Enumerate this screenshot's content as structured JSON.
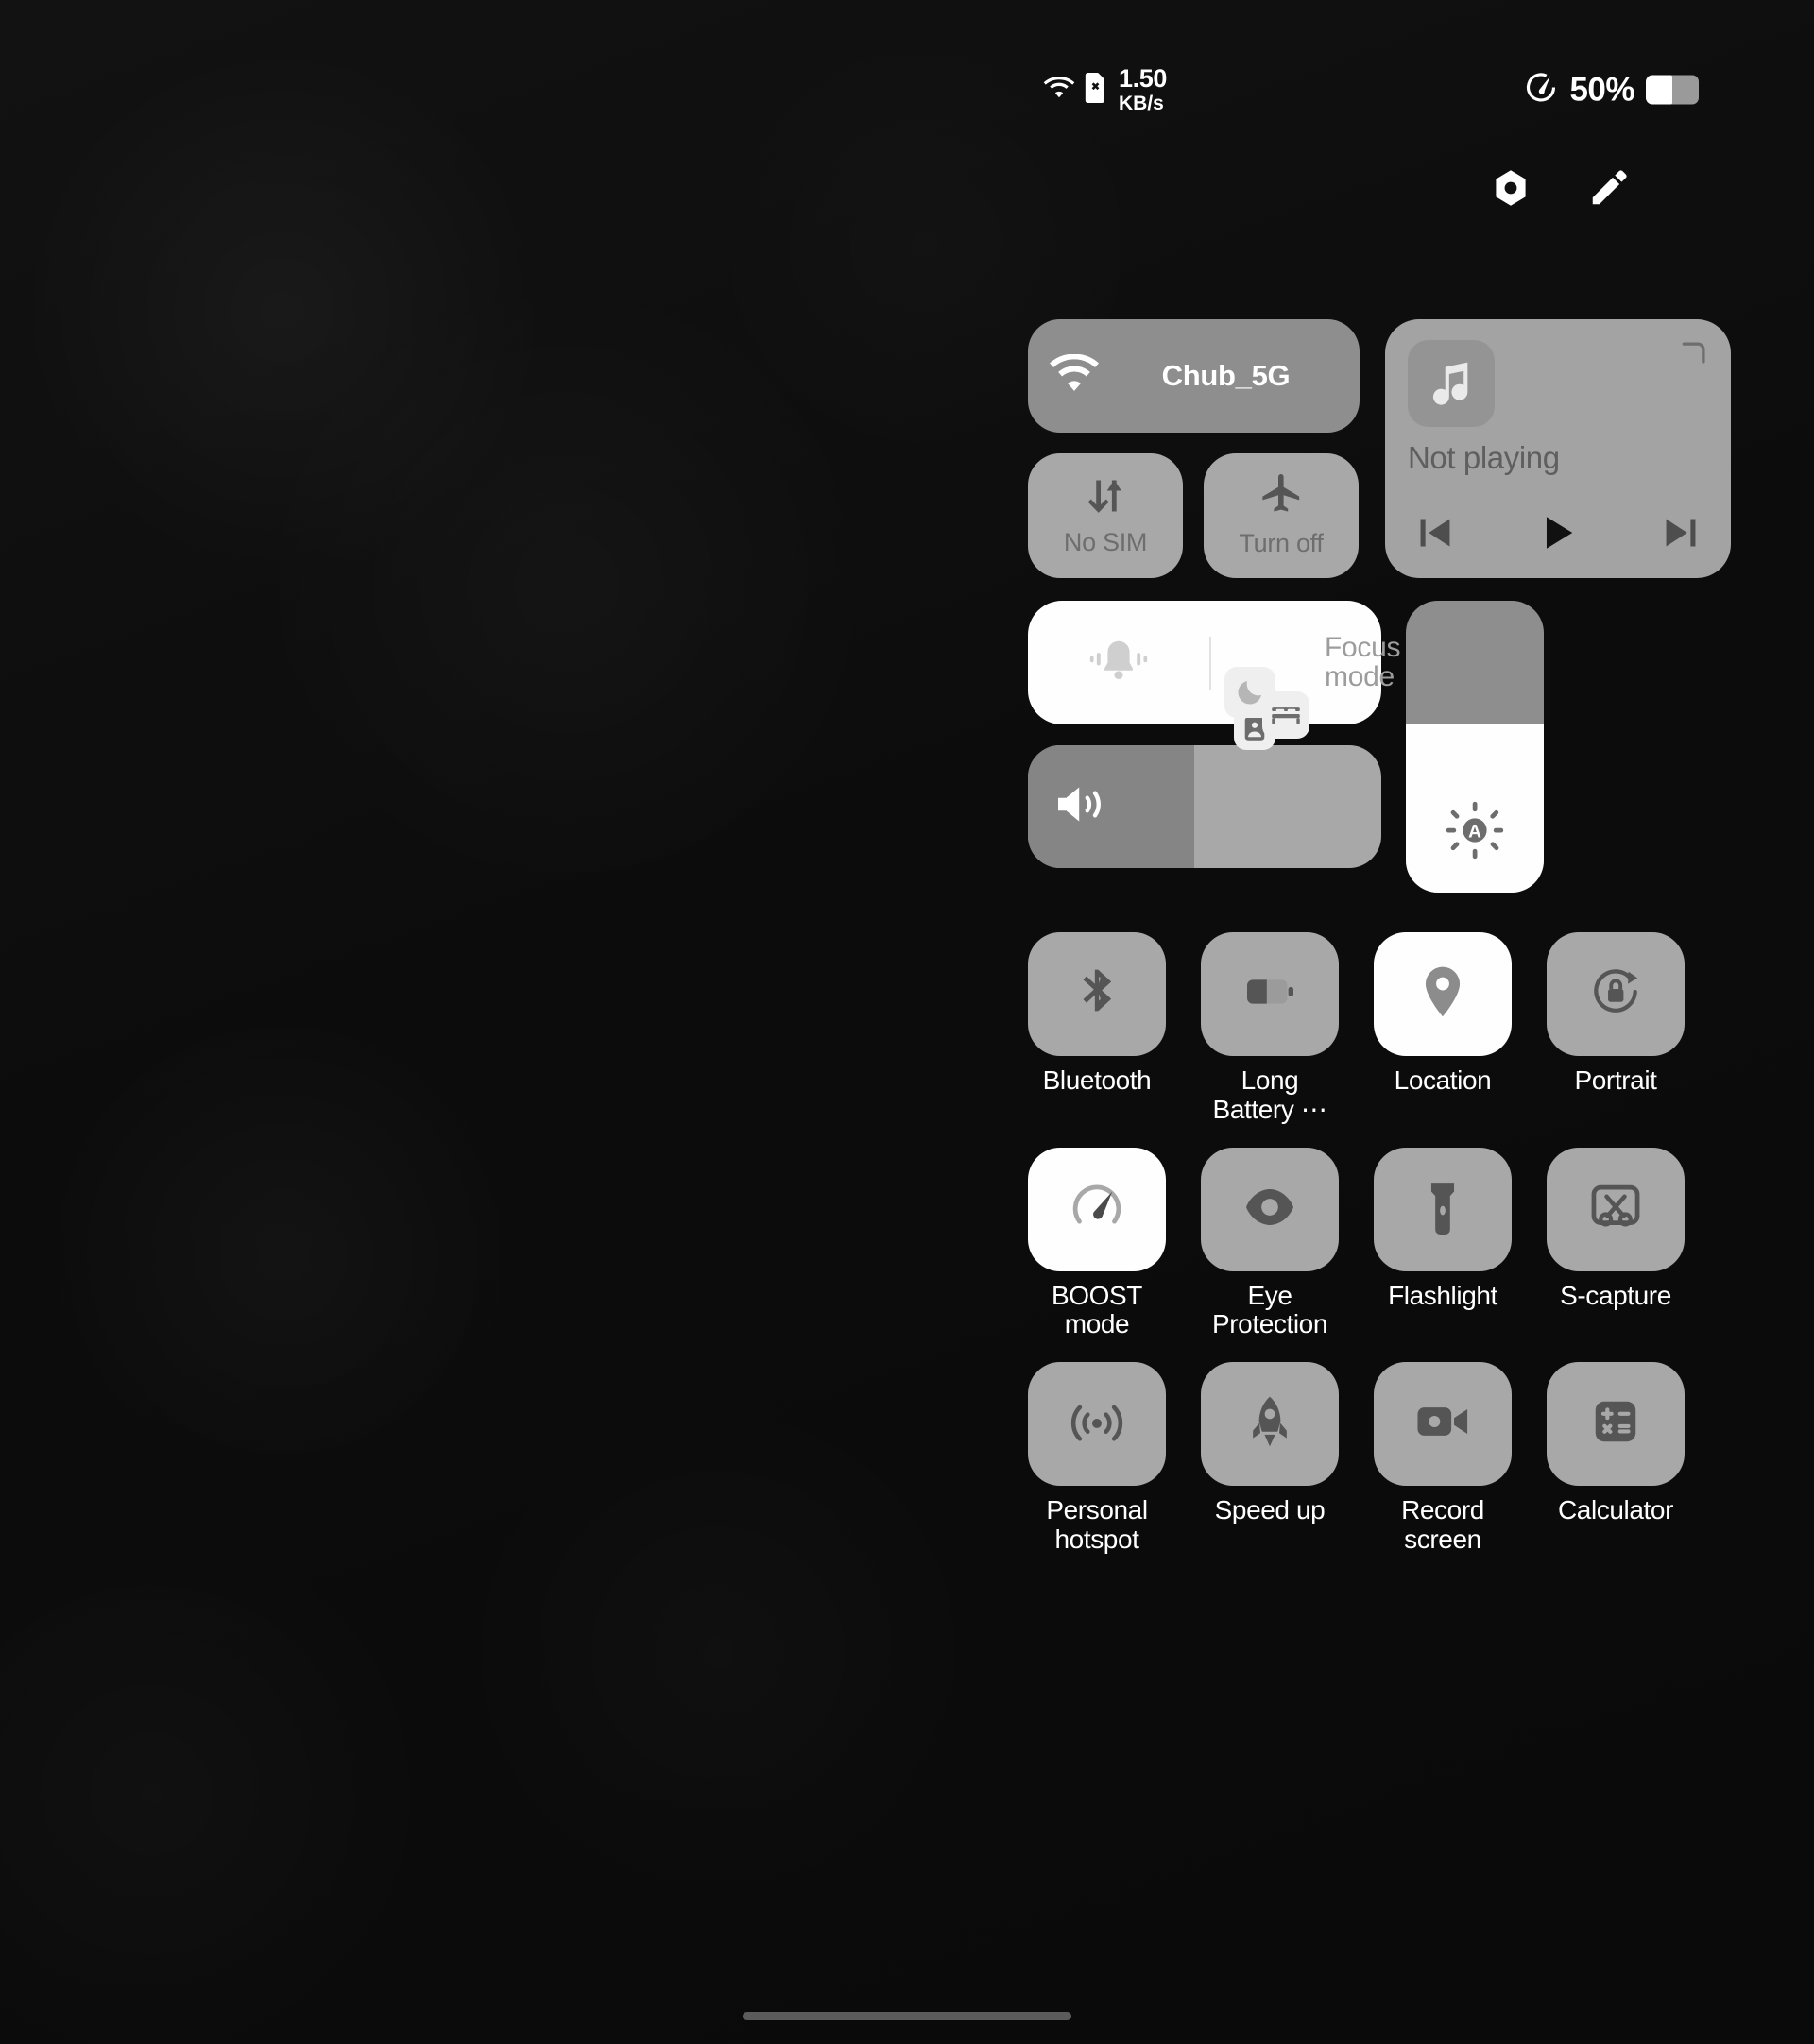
{
  "status_bar": {
    "wifi_icon": "wifi-icon",
    "sim_icon": "sim-card-off-icon",
    "network_speed_value": "1.50",
    "network_speed_unit": "KB/s",
    "performance_icon": "speedometer-icon",
    "battery_percent_label": "50%",
    "battery_level": 50,
    "battery_icon": "battery-icon"
  },
  "header": {
    "settings_icon": "gear-nut-icon",
    "edit_icon": "pencil-icon"
  },
  "connectivity": {
    "wifi": {
      "label": "Chub_5G",
      "icon": "wifi-icon",
      "active": true,
      "bg": "#8e8e8e"
    },
    "mobile_data": {
      "label": "No SIM",
      "icon": "data-transfer-icon",
      "active": false,
      "bg": "#a8a8a8"
    },
    "airplane": {
      "label": "Turn off",
      "icon": "airplane-icon",
      "active": false,
      "bg": "#a8a8a8"
    }
  },
  "media": {
    "title": "Not playing",
    "album_art_icon": "music-note-icon",
    "prev_icon": "skip-previous-icon",
    "play_icon": "play-icon",
    "next_icon": "skip-next-icon",
    "corner_icon": "cast-corner-icon",
    "bg": "#a3a3a3"
  },
  "focus_card": {
    "ring_mode_icon": "bell-vibrate-icon",
    "label": "Focus\nmode",
    "label_line1": "Focus",
    "label_line2": "mode",
    "chips": [
      {
        "name": "do-not-disturb-moon-icon"
      },
      {
        "name": "work-badge-icon"
      },
      {
        "name": "sleep-bed-icon"
      }
    ],
    "bg": "#fefefe"
  },
  "volume_slider": {
    "icon": "volume-up-icon",
    "value_percent": 47,
    "fill_color": "#858585",
    "track_color": "#a8a8a8"
  },
  "brightness_slider": {
    "icon": "auto-brightness-icon",
    "value_percent": 58,
    "fill_color": "#fefefe",
    "track_color": "#8e8e8e"
  },
  "toggles": [
    {
      "label": "Bluetooth",
      "icon": "bluetooth-icon",
      "active": false
    },
    {
      "label": "Long\nBattery ⋯",
      "icon": "battery-saver-icon",
      "active": false
    },
    {
      "label": "Location",
      "icon": "location-pin-icon",
      "active": true
    },
    {
      "label": "Portrait",
      "icon": "rotation-lock-icon",
      "active": false
    },
    {
      "label": "BOOST\nmode",
      "icon": "speedometer-icon",
      "active": true
    },
    {
      "label": "Eye\nProtection",
      "icon": "eye-icon",
      "active": false
    },
    {
      "label": "Flashlight",
      "icon": "flashlight-icon",
      "active": false
    },
    {
      "label": "S-capture",
      "icon": "screen-capture-icon",
      "active": false
    },
    {
      "label": "Personal\nhotspot",
      "icon": "hotspot-icon",
      "active": false
    },
    {
      "label": "Speed up",
      "icon": "rocket-icon",
      "active": false
    },
    {
      "label": "Record\nscreen",
      "icon": "video-camera-icon",
      "active": false
    },
    {
      "label": "Calculator",
      "icon": "calculator-icon",
      "active": false
    }
  ],
  "navigation": {
    "home_indicator": "home-gesture-bar"
  },
  "theme": {
    "background": "#0c0c0c",
    "tile_inactive": "#a8a8a8",
    "tile_active": "#fefefe",
    "icon_inactive": "#555555",
    "label_color": "#ffffff"
  }
}
